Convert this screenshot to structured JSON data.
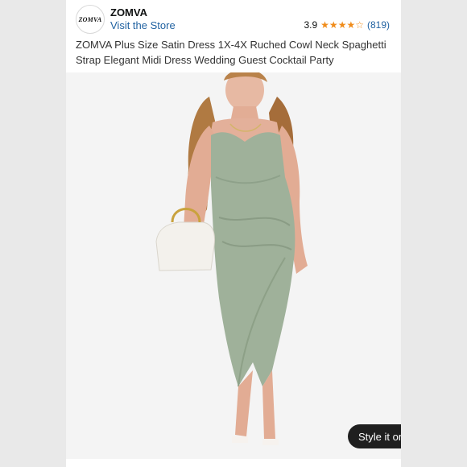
{
  "header": {
    "logo_text": "ZOMVA",
    "brand": "ZOMVA",
    "store_link": "Visit the Store",
    "rating_value": "3.9",
    "rating_stars": 3.9,
    "rating_count": "(819)"
  },
  "product": {
    "title": "ZOMVA Plus Size Satin Dress 1X-4X Ruched Cowl Neck Spaghetti Strap Elegant Midi Dress Wedding Guest Cocktail Party"
  },
  "image": {
    "dress_color": "#9fb19a",
    "background_color": "#f4f4f4"
  },
  "style_button": {
    "label": "Style it on you",
    "icon": "sparkle-icon"
  },
  "colors": {
    "link": "#2162a1",
    "star": "#f08c1a"
  }
}
